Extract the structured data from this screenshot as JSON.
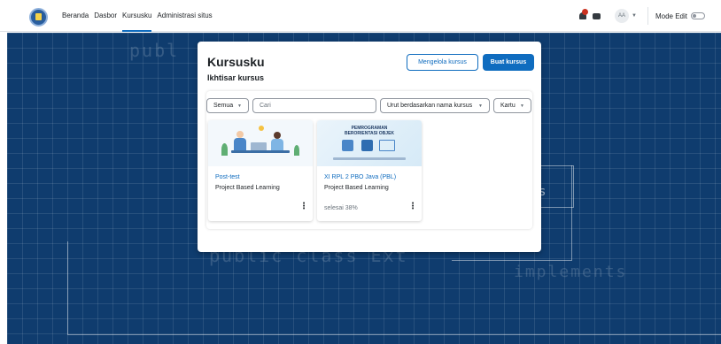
{
  "nav": {
    "links": [
      "Beranda",
      "Dasbor",
      "Kursusku",
      "Administrasi situs"
    ],
    "active_index": 2,
    "avatar_initials": "AA",
    "edit_mode_label": "Mode Edit",
    "edit_mode_on": false
  },
  "background_text": {
    "word1": "publ",
    "word2": "public class Ext",
    "word3": "implements",
    "word4": "s"
  },
  "card": {
    "title": "Kursusku",
    "subtitle": "Ikhtisar kursus",
    "manage_button": "Mengelola kursus",
    "create_button": "Buat kursus"
  },
  "filters": {
    "grouping": "Semua",
    "search_placeholder": "Cari",
    "sort": "Urut berdasarkan nama kursus",
    "view": "Kartu"
  },
  "courses": [
    {
      "name": "Post-test",
      "category": "Project Based Learning",
      "progress_text": ""
    },
    {
      "name": "XI RPL 2 PBO Java (PBL)",
      "category": "Project Based Learning",
      "progress_text": "selesai 38%",
      "thumb_title_line1": "PEMROGRAMAN",
      "thumb_title_line2": "BERORIENTASI OBJEK"
    }
  ],
  "colors": {
    "primary": "#0f6cbf",
    "background": "#0f3c6e",
    "text": "#1d2125",
    "muted": "#6a737b",
    "notification": "#ca3120"
  }
}
